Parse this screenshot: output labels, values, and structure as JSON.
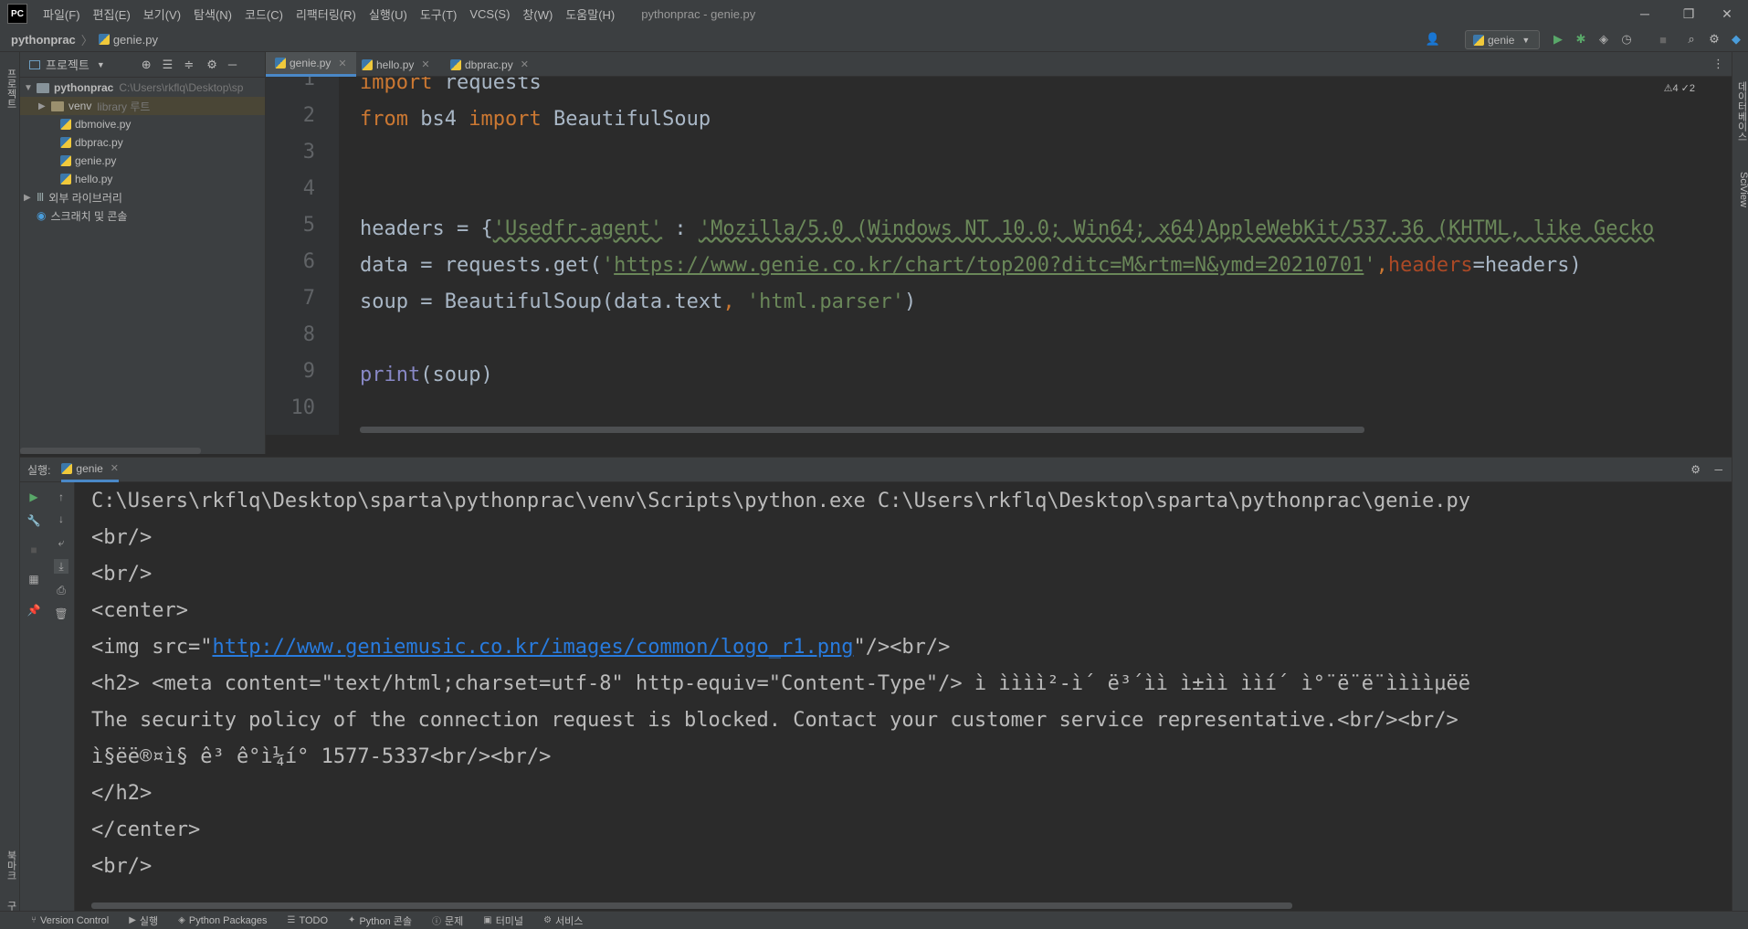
{
  "titlebar": {
    "logo": "PC",
    "menu": [
      "파일(F)",
      "편집(E)",
      "보기(V)",
      "탐색(N)",
      "코드(C)",
      "리팩터링(R)",
      "실행(U)",
      "도구(T)",
      "VCS(S)",
      "창(W)",
      "도움말(H)"
    ],
    "window_title": "pythonprac - genie.py",
    "minimize": "─",
    "maximize": "❐",
    "close": "✕"
  },
  "navbar": {
    "project": "pythonprac",
    "separator": "〉",
    "file": "genie.py",
    "run_config": "genie"
  },
  "left_strip": {
    "top_tab": "프로젝트",
    "bottom_tab1": "북마크",
    "bottom_tab2": "구조"
  },
  "project": {
    "title": "프로젝트",
    "root": "pythonprac",
    "root_path": "C:\\Users\\rkflq\\Desktop\\sp",
    "venv": "venv",
    "venv_note": "library 루트",
    "files": [
      "dbmoive.py",
      "dbprac.py",
      "genie.py",
      "hello.py"
    ],
    "external": "외부 라이브러리",
    "scratches": "스크래치 및 콘솔"
  },
  "tabs": [
    {
      "label": "genie.py",
      "active": true
    },
    {
      "label": "hello.py",
      "active": false
    },
    {
      "label": "dbprac.py",
      "active": false
    }
  ],
  "editor": {
    "line_numbers": [
      "1",
      "2",
      "3",
      "4",
      "5",
      "6",
      "7",
      "8",
      "9",
      "10"
    ],
    "inspections": "⚠4 ✓2",
    "l1_kw": "import",
    "l1_rest": " requests",
    "l2_kw1": "from",
    "l2_mid": " bs4 ",
    "l2_kw2": "import",
    "l2_rest": " BeautifulSoup",
    "l5_a": "headers = {",
    "l5_str1": "'Usedfr-agent'",
    "l5_b": " : ",
    "l5_str2": "'Mozilla/5.0 (Windows NT 10.0; Win64; x64)AppleWebKit/537.36 (KHTML, like Gecko",
    "l6_a": "data = requests.get(",
    "l6_q1": "'",
    "l6_url": "https://www.genie.co.kr/chart/top200?ditc=M&rtm=N&ymd=20210701",
    "l6_q2": "'",
    "l6_comma": ",",
    "l6_param": "headers",
    "l6_b": "=headers)",
    "l7_a": "soup = BeautifulSoup(data.text",
    "l7_comma": ", ",
    "l7_str": "'html.parser'",
    "l7_b": ")",
    "l9_builtin": "print",
    "l9_rest": "(soup)"
  },
  "run": {
    "label": "실행:",
    "tab": "genie",
    "lines": {
      "cmd": "C:\\Users\\rkflq\\Desktop\\sparta\\pythonprac\\venv\\Scripts\\python.exe C:\\Users\\rkflq\\Desktop\\sparta\\pythonprac\\genie.py",
      "br1": "<br/>",
      "br2": "<br/>",
      "center": "<center>",
      "img_a": "<img src=\"",
      "img_url": "http://www.geniemusic.co.kr/images/common/logo_r1.png",
      "img_b": "\"/><br/>",
      "h2": "<h2> <meta content=\"text/html;charset=utf-8\" http-equiv=\"Content-Type\"/> ì ìììì²-ì´ ë³´ìì ì±ìì ììí´ ì°¨ë¨ë¨ììììµëë",
      "policy": "The security policy of the connection request is blocked. Contact your customer service representative.<br/><br/>",
      "phone": "ì§ëë®¤ì§ ê³ ê°ì¼í° 1577-5337<br/><br/>",
      "h2_close": "</h2>",
      "center_close": "</center>",
      "br3": "<br/>"
    }
  },
  "bottom_bar": [
    "Version Control",
    "실행",
    "Python Packages",
    "TODO",
    "Python 콘솔",
    "문제",
    "터미널",
    "서비스"
  ],
  "right_strip": {
    "tab1": "데이터베이스",
    "tab2": "SciView"
  }
}
